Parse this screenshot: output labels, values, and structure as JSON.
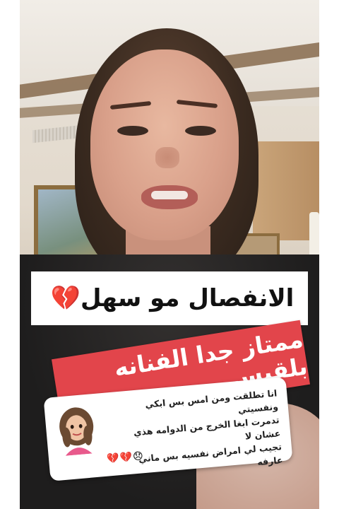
{
  "story": {
    "caption_white": "الانفصال مو سهل",
    "caption_white_emoji": "💔",
    "caption_red": "ممتاز جدا الفنانه بلقيس"
  },
  "comment": {
    "lines": [
      "انا تطلقت ومن امس بس ابكي ونفسيتي",
      "تدمرت ابغا الخرج من الدوامه هذي عشان لا",
      "تجيب لي امراض نفسيه بس ماني عارفه"
    ],
    "emojis": "💔💔😞"
  },
  "colors": {
    "caption_red_bg": "#e2454b",
    "caption_white_bg": "#ffffff"
  }
}
